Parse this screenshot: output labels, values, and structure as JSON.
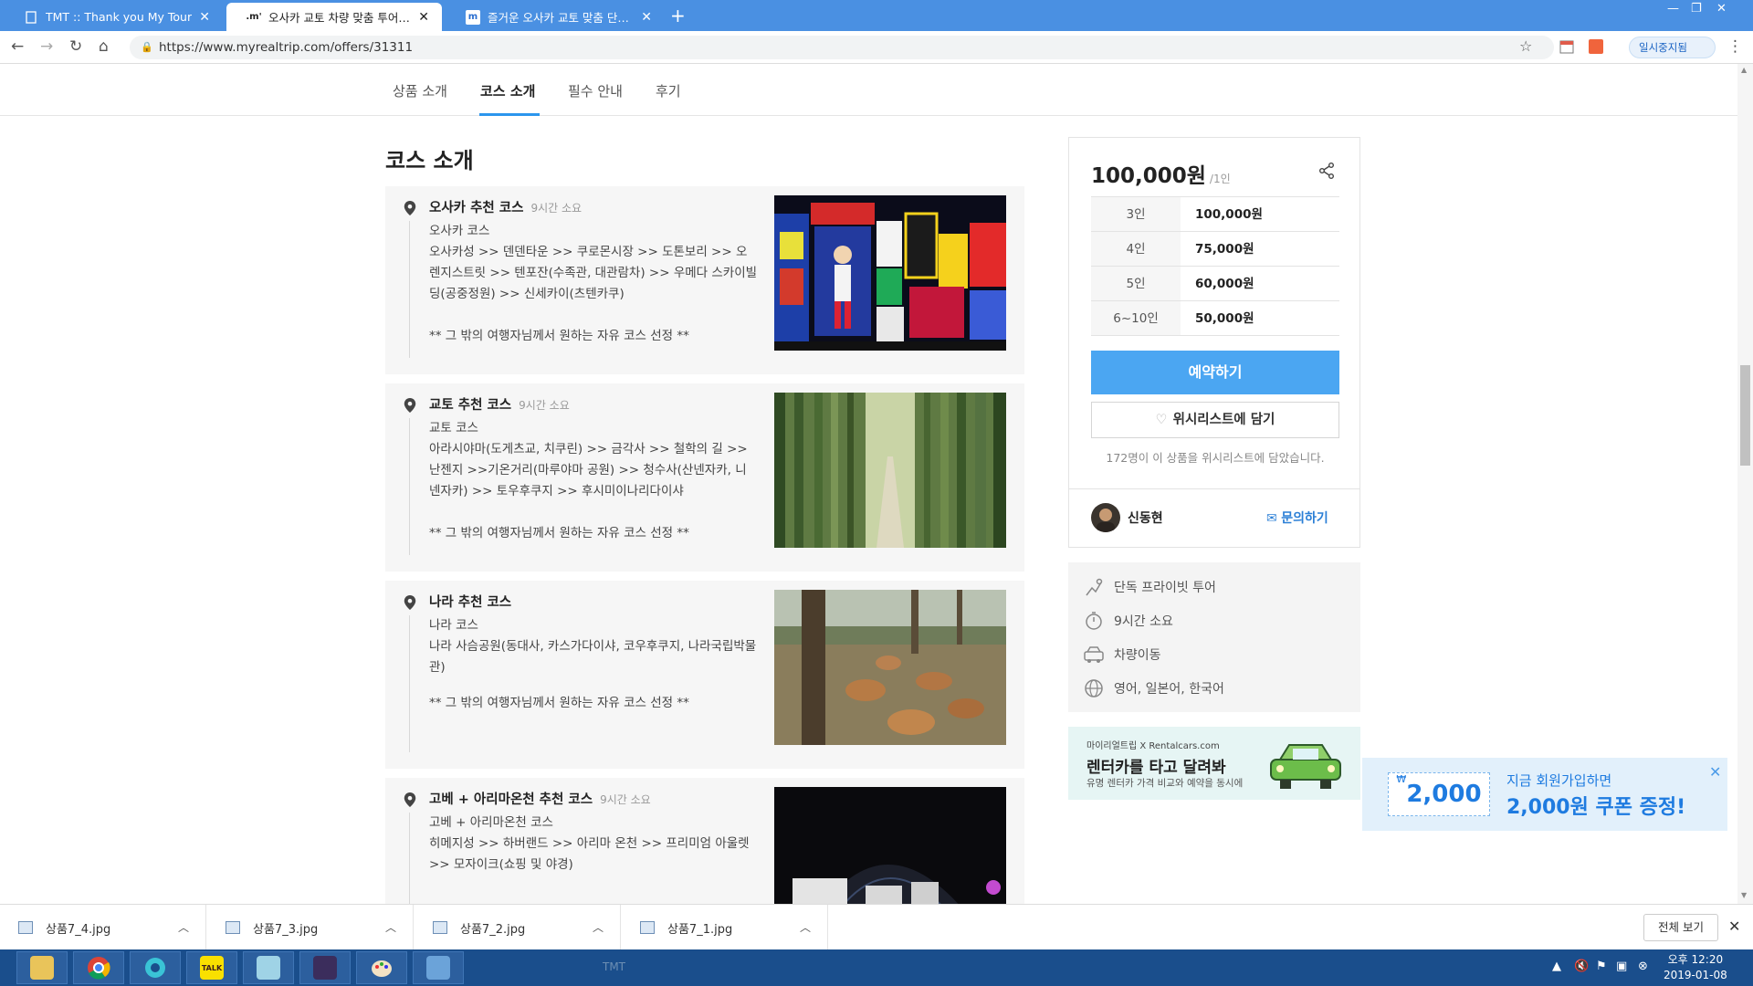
{
  "browser": {
    "tabs": [
      {
        "title": "TMT :: Thank you My Tour",
        "favicon": "page-icon",
        "active": false
      },
      {
        "title": "오사카 교토 차량 맞춤 투어 :: 여",
        "favicon": ".m'",
        "active": true
      },
      {
        "title": "즐거운 오사카 교토 맞춤 단독투",
        "favicon": "m",
        "active": false
      }
    ],
    "new_tab": "+",
    "url": "https://www.myrealtrip.com/offers/31311",
    "pause_label": "일시중지됨"
  },
  "subnav": {
    "items": [
      {
        "label": "상품 소개",
        "active": false
      },
      {
        "label": "코스 소개",
        "active": true
      },
      {
        "label": "필수 안내",
        "active": false
      },
      {
        "label": "후기",
        "active": false
      }
    ]
  },
  "section_title": "코스 소개",
  "courses": [
    {
      "title": "오사카 추천 코스",
      "duration": "9시간 소요",
      "subtitle": "오사카 코스",
      "route": "오사카성 >> 덴덴타운 >> 쿠로몬시장 >> 도톤보리 >> 오렌지스트릿 >> 텐포잔(수족관, 대관람차) >> 우메다 스카이빌딩(공중정원) >> 신세카이(츠텐카쿠)",
      "note": "** 그 밖의 여행자님께서 원하는 자유 코스 선정 **",
      "photo": "osaka-glico-sign-photo"
    },
    {
      "title": "교토 추천 코스",
      "duration": "9시간 소요",
      "subtitle": "교토 코스",
      "route": "아라시야마(도게츠교, 치쿠린) >> 금각사 >> 철학의 길 >> 난젠지 >>기온거리(마루야마 공원) >> 청수사(산넨자카, 니넨자카) >> 토우후쿠지 >> 후시미이나리다이샤",
      "note": "** 그 밖의 여행자님께서 원하는 자유 코스 선정 **",
      "photo": "kyoto-bamboo-photo"
    },
    {
      "title": "나라 추천 코스",
      "duration": "",
      "subtitle": "나라 코스",
      "route": "나라 사슴공원(동대사, 카스가다이샤, 코우후쿠지, 나라국립박물관)",
      "note": "** 그 밖의 여행자님께서 원하는 자유 코스 선정 **",
      "photo": "nara-deer-photo"
    },
    {
      "title": "고베 + 아리마온천 추천 코스",
      "duration": "9시간 소요",
      "subtitle": "고베 + 아리마온천 코스",
      "route": "히메지성 >> 하버랜드 >> 아리마 온천 >> 프리미엄 아울렛 >> 모자이크(쇼핑 및 야경)",
      "note": "",
      "photo": "kobe-night-photo"
    }
  ],
  "pricing": {
    "price": "100,000원",
    "per": "/1인",
    "table": [
      {
        "count": "3인",
        "price": "100,000원"
      },
      {
        "count": "4인",
        "price": "75,000원"
      },
      {
        "count": "5인",
        "price": "60,000원"
      },
      {
        "count": "6~10인",
        "price": "50,000원"
      }
    ],
    "book_label": "예약하기",
    "wishlist_label": "위시리스트에 담기",
    "wishlist_count_text": "172명이 이 상품을 위시리스트에 담았습니다.",
    "guide_name": "신동현",
    "inquire_label": "문의하기"
  },
  "info_items": [
    {
      "icon": "private-tour-icon",
      "label": "단독 프라이빗 투어"
    },
    {
      "icon": "stopwatch-icon",
      "label": "9시간 소요"
    },
    {
      "icon": "car-icon",
      "label": "차량이동"
    },
    {
      "icon": "globe-icon",
      "label": "영어, 일본어, 한국어"
    }
  ],
  "rent_banner": {
    "small": "마이리얼트립 X Rentalcars.com",
    "main": "렌터카를 타고 달려봐",
    "sub": "유명 렌터카 가격 비교와 예약을 동시에"
  },
  "coupon": {
    "ticket_currency": "₩",
    "ticket_amount": "2,000",
    "line1": "지금 회원가입하면",
    "line2": "2,000원 쿠폰 증정!"
  },
  "downloads": {
    "files": [
      "상품7_4.jpg",
      "상품7_3.jpg",
      "상품7_2.jpg",
      "상품7_1.jpg"
    ],
    "show_all": "전체 보기"
  },
  "taskbar": {
    "apps": [
      "file-explorer",
      "chrome",
      "network-app",
      "kakaotalk",
      "notes",
      "java-ee",
      "paint",
      "remote-desktop"
    ],
    "ghost_label": "TMT",
    "time": "오후 12:20",
    "date": "2019-01-08"
  },
  "colors": {
    "chrome_blue": "#4a90e2",
    "accent": "#4ba6f2",
    "tab_underline": "#2b96ed",
    "link": "#2b7fd6"
  }
}
